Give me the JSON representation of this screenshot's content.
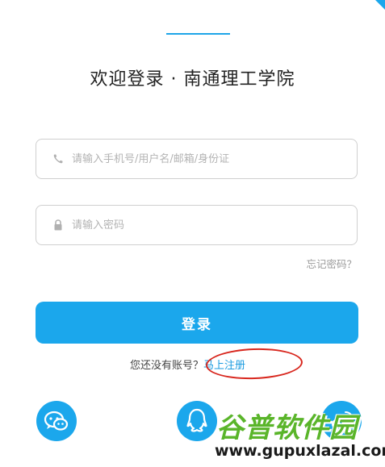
{
  "header": {
    "title": "欢迎登录 · 南通理工学院"
  },
  "login_form": {
    "account_placeholder": "请输入手机号/用户名/邮箱/身份证",
    "account_value": "",
    "password_placeholder": "请输入密码",
    "password_value": "",
    "forgot_label": "忘记密码？",
    "submit_label": "登录"
  },
  "signup": {
    "prompt": "您还没有账号？",
    "link_label": "马上注册"
  },
  "social_logins": [
    {
      "icon": "wechat-icon"
    },
    {
      "icon": "qq-icon"
    },
    {
      "icon": "weibo-icon"
    }
  ],
  "watermark": {
    "title": "谷普软件园",
    "url": "www.gupuxlazal.com"
  },
  "colors": {
    "accent": "#1ba7ec",
    "link": "#1a9be0",
    "annotation": "#d8261d",
    "watermark_green": "#5ab52a"
  }
}
